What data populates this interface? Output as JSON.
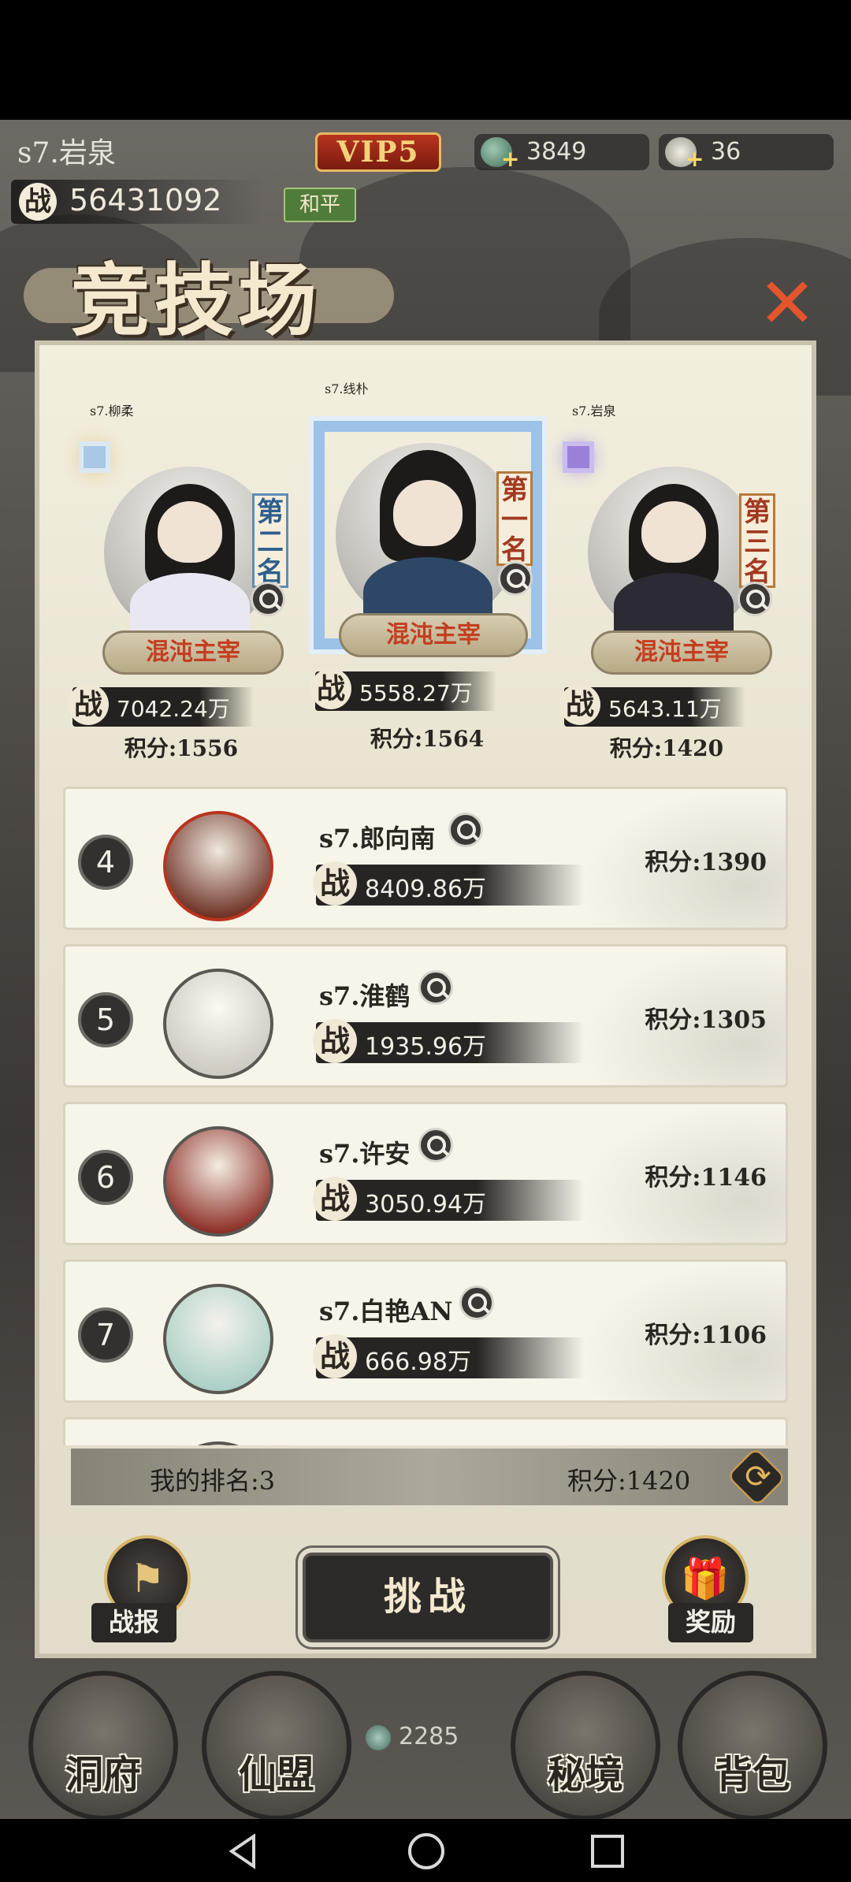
{
  "hud": {
    "player_name": "s7.岩泉",
    "vip": "VIP5",
    "currency_1": "3849",
    "currency_2": "36",
    "power_label": "战",
    "power": "56431092",
    "mode": "和平"
  },
  "title": "竞技场",
  "podium": [
    {
      "name": "s7.柳柔",
      "rank_tag": "第二名",
      "plate": "混沌主宰",
      "power": "7042.24万",
      "score": "积分:1556"
    },
    {
      "name": "s7.线朴",
      "rank_tag": "第一名",
      "plate": "混沌主宰",
      "power": "5558.27万",
      "score": "积分:1564"
    },
    {
      "name": "s7.岩泉",
      "rank_tag": "第三名",
      "plate": "混沌主宰",
      "power": "5643.11万",
      "score": "积分:1420"
    }
  ],
  "zhan": "战",
  "ranking": [
    {
      "rank": "4",
      "name": "s7.郎向南",
      "power": "8409.86万",
      "score": "积分:1390"
    },
    {
      "rank": "5",
      "name": "s7.淮鹤",
      "power": "1935.96万",
      "score": "积分:1305"
    },
    {
      "rank": "6",
      "name": "s7.许安",
      "power": "3050.94万",
      "score": "积分:1146"
    },
    {
      "rank": "7",
      "name": "s7.白艳AN",
      "power": "666.98万",
      "score": "积分:1106"
    }
  ],
  "my": {
    "rank": "我的排名:3",
    "score": "积分:1420"
  },
  "buttons": {
    "report": "战报",
    "challenge": "挑战",
    "reward": "奖励"
  },
  "bottom_nav": [
    "洞府",
    "仙盟",
    "秘境",
    "背包"
  ],
  "jade": "2285",
  "colors": {
    "accent": "#d8b76a",
    "close": "#e4552c",
    "vip": "#b8341f"
  }
}
